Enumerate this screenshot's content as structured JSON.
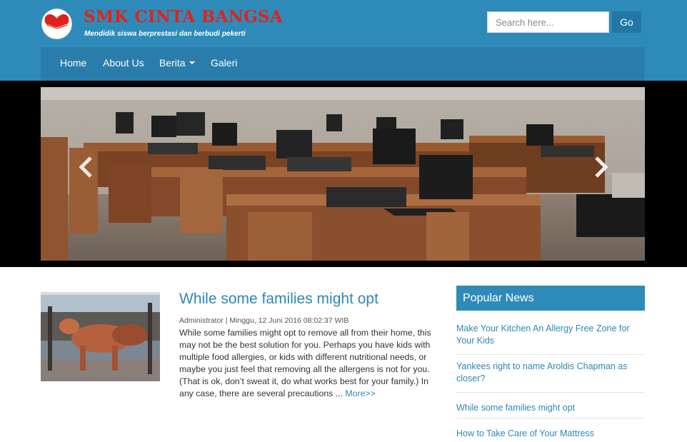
{
  "header": {
    "brand_title": "SMK CINTA BANGSA",
    "brand_tagline": "Mendidik siswa berprestasi dan berbudi pekerti",
    "search": {
      "placeholder": "Search here...",
      "value": ""
    },
    "go_label": "Go"
  },
  "nav": {
    "items": [
      {
        "label": "Home"
      },
      {
        "label": "About Us"
      },
      {
        "label": "Berita"
      },
      {
        "label": "Galeri"
      }
    ]
  },
  "slider": {
    "image": "computer-lab-photo",
    "prev_icon": "chevron-left-icon",
    "next_icon": "chevron-right-icon"
  },
  "article": {
    "title": "While some families might opt",
    "meta": "Administrator | Minggu, 12 Juni 2016 08:02:37 WIB",
    "excerpt": "While some families might opt to remove all from their home, this may not be the best solution for you.  Perhaps you have kids with multiple food allergies, or kids with different nutritional needs, or maybe you just feel that removing all the allergens is not for you. (That is ok, don’t sweat it, do what works best for your family.)  In any case, there are several precautions ...",
    "more_label": "More>>"
  },
  "sidebar": {
    "title": "Popular News",
    "items": [
      {
        "label": "Make Your Kitchen An Allergy Free Zone for Your Kids"
      },
      {
        "label": "Yankees right to name Aroldis Chapman as closer?"
      },
      {
        "label": "While some families might opt"
      },
      {
        "label": "How to Take Care of Your Mattress"
      }
    ]
  },
  "colors": {
    "header_bg": "#2e8bb9",
    "nav_bg": "#2a7dab",
    "brand_red": "#e0221b",
    "link_blue": "#2e87b7"
  }
}
